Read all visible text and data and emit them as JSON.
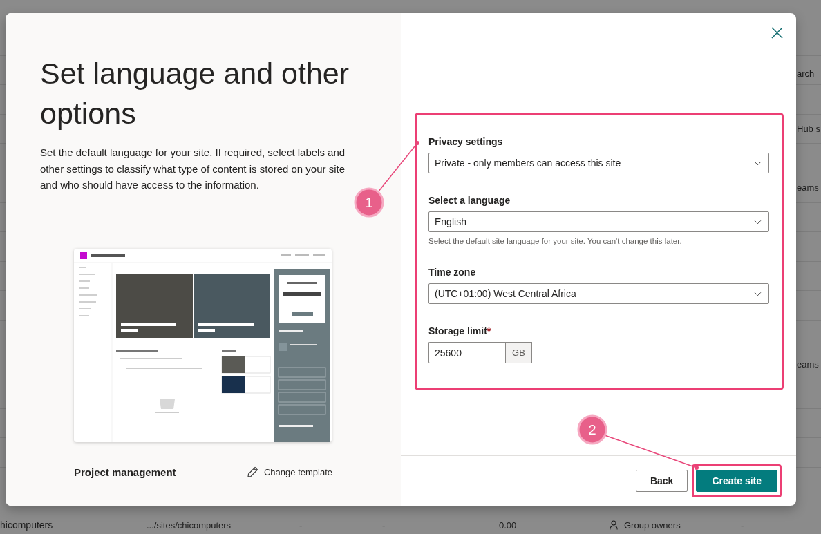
{
  "background": {
    "right_cells": [
      {
        "kind": "search",
        "placeholder": "arch"
      },
      {
        "kind": "text",
        "text": "Hub s"
      },
      {
        "kind": "text",
        "text": "eams"
      },
      {
        "kind": "text",
        "text": "eams"
      }
    ],
    "bottom_row": {
      "name": "hicomputers",
      "url": ".../sites/chicomputers",
      "column_3": "-",
      "column_4": "-",
      "column_5": "0.00",
      "owner": "Group owners",
      "column_7": "-"
    }
  },
  "dialog": {
    "title": "Set language and other options",
    "description": "Set the default language for your site. If required, select labels and other settings to classify what type of content is stored on your site and who should have access to the information.",
    "template": {
      "name": "Project management",
      "change_label": "Change template"
    },
    "fields": [
      {
        "kind": "dropdown",
        "label": "Privacy settings",
        "value": "Private - only members can access this site"
      },
      {
        "kind": "dropdown",
        "label": "Select a language",
        "value": "English",
        "help": "Select the default site language for your site. You can't change this later."
      },
      {
        "kind": "dropdown",
        "label": "Time zone",
        "value": "(UTC+01:00) West Central Africa"
      },
      {
        "kind": "number",
        "label": "Storage limit",
        "required_mark": "*",
        "value": "25600",
        "unit": "GB"
      }
    ],
    "buttons": [
      {
        "label": "Back",
        "primary": false
      },
      {
        "label": "Create site",
        "primary": true
      }
    ]
  },
  "annotations": [
    {
      "number": "1"
    },
    {
      "number": "2"
    }
  ]
}
